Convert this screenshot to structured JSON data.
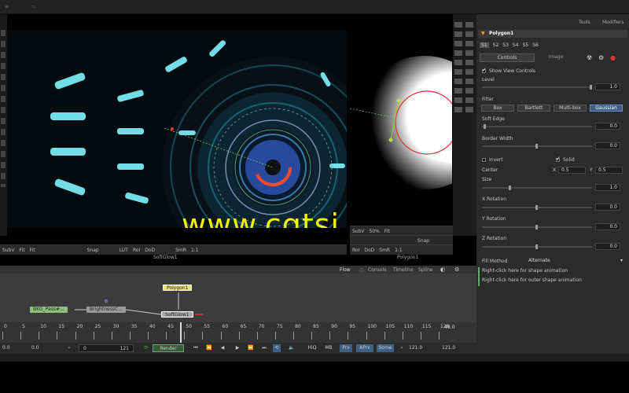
{
  "app": {
    "menu_items": [
      "Tools",
      "Modifiers"
    ]
  },
  "viewer_left": {
    "toolbar": [
      "SubV",
      "Fit",
      "Fit",
      "Snap",
      "LUT",
      "RoI",
      "DoD",
      "SmR",
      "1:1"
    ],
    "label": "SoftGlow1"
  },
  "viewer_right": {
    "toolbar_top": [
      "SubV",
      "50%",
      "Fit"
    ],
    "toolbar_mid": [
      "Snap"
    ],
    "toolbar_bottom": [
      "RoI",
      "DoD",
      "SmR",
      "1:1"
    ],
    "label": "Polygon1"
  },
  "panel": {
    "tabs": [
      "Tools",
      "Modifiers"
    ],
    "tool_name": "Polygon1",
    "slots": [
      "S1",
      "S2",
      "S3",
      "S4",
      "S5",
      "S6"
    ],
    "subtabs": [
      "Controls",
      "Image"
    ],
    "show_view_controls": "Show View Controls",
    "level_label": "Level",
    "level_value": "1.0",
    "filter_label": "Filter",
    "filters": [
      "Box",
      "Bartlett",
      "Multi-box",
      "Gaussian"
    ],
    "active_filter": "Gaussian",
    "soft_edge_label": "Soft Edge",
    "soft_edge_value": "0.0",
    "border_width_label": "Border Width",
    "border_width_value": "0.0",
    "invert_label": "Invert",
    "solid_label": "Solid",
    "center_label": "Center",
    "center_x_label": "X",
    "center_x": "0.5",
    "center_y_label": "Y",
    "center_y": "0.5",
    "size_label": "Size",
    "size_value": "1.0",
    "x_rotation_label": "X Rotation",
    "x_rotation_value": "0.0",
    "y_rotation_label": "Y Rotation",
    "y_rotation_value": "0.0",
    "z_rotation_label": "Z Rotation",
    "z_rotation_value": "0.0",
    "fill_method_label": "Fill Method",
    "fill_method_value": "Alternate",
    "hint1": "Right-click here for shape animation",
    "hint2": "Right-click here for outer shape animation"
  },
  "flow": {
    "tabs": [
      "Flow",
      "Console",
      "Timeline",
      "Spline"
    ],
    "nodes": {
      "polygon": "Polygon1",
      "bkg": "BKG_Pass#...",
      "brightness": "BrightnessC...",
      "softglow": "SoftGlow1"
    }
  },
  "timeline": {
    "ticks": [
      "0",
      "5",
      "10",
      "15",
      "20",
      "25",
      "30",
      "35",
      "40",
      "45",
      "50",
      "55",
      "60",
      "65",
      "70",
      "75",
      "80",
      "85",
      "90",
      "95",
      "100",
      "105",
      "110",
      "115",
      "120"
    ],
    "end_value": "49.0"
  },
  "transport": {
    "start": "0.0",
    "current_start": "0.0",
    "render_start": "0",
    "render_end": "121",
    "render_label": "Render",
    "hiq": "HiQ",
    "mb": "MB",
    "prx": "Prx",
    "aprx": "APrx",
    "some": "Some",
    "end1": "121.0",
    "end2": "121.0"
  },
  "watermark": "www.cgtsj.com",
  "colors": {
    "accent_yellow": "#f0f000",
    "active_blue": "#3e5f86",
    "node_yellow": "#e8e07a",
    "node_green": "#8fbf7a"
  }
}
